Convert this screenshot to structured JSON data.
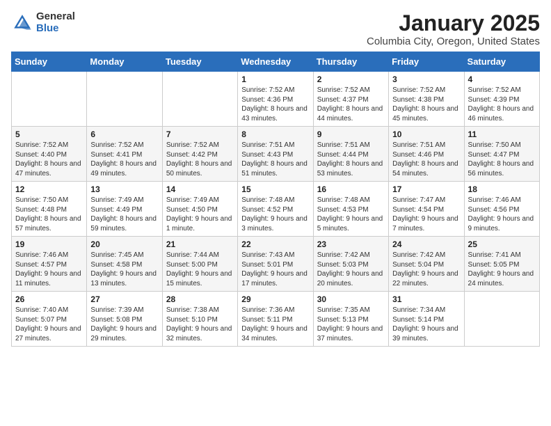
{
  "logo": {
    "general": "General",
    "blue": "Blue"
  },
  "header": {
    "title": "January 2025",
    "subtitle": "Columbia City, Oregon, United States"
  },
  "weekdays": [
    "Sunday",
    "Monday",
    "Tuesday",
    "Wednesday",
    "Thursday",
    "Friday",
    "Saturday"
  ],
  "weeks": [
    [
      {
        "day": "",
        "info": ""
      },
      {
        "day": "",
        "info": ""
      },
      {
        "day": "",
        "info": ""
      },
      {
        "day": "1",
        "info": "Sunrise: 7:52 AM\nSunset: 4:36 PM\nDaylight: 8 hours and 43 minutes."
      },
      {
        "day": "2",
        "info": "Sunrise: 7:52 AM\nSunset: 4:37 PM\nDaylight: 8 hours and 44 minutes."
      },
      {
        "day": "3",
        "info": "Sunrise: 7:52 AM\nSunset: 4:38 PM\nDaylight: 8 hours and 45 minutes."
      },
      {
        "day": "4",
        "info": "Sunrise: 7:52 AM\nSunset: 4:39 PM\nDaylight: 8 hours and 46 minutes."
      }
    ],
    [
      {
        "day": "5",
        "info": "Sunrise: 7:52 AM\nSunset: 4:40 PM\nDaylight: 8 hours and 47 minutes."
      },
      {
        "day": "6",
        "info": "Sunrise: 7:52 AM\nSunset: 4:41 PM\nDaylight: 8 hours and 49 minutes."
      },
      {
        "day": "7",
        "info": "Sunrise: 7:52 AM\nSunset: 4:42 PM\nDaylight: 8 hours and 50 minutes."
      },
      {
        "day": "8",
        "info": "Sunrise: 7:51 AM\nSunset: 4:43 PM\nDaylight: 8 hours and 51 minutes."
      },
      {
        "day": "9",
        "info": "Sunrise: 7:51 AM\nSunset: 4:44 PM\nDaylight: 8 hours and 53 minutes."
      },
      {
        "day": "10",
        "info": "Sunrise: 7:51 AM\nSunset: 4:46 PM\nDaylight: 8 hours and 54 minutes."
      },
      {
        "day": "11",
        "info": "Sunrise: 7:50 AM\nSunset: 4:47 PM\nDaylight: 8 hours and 56 minutes."
      }
    ],
    [
      {
        "day": "12",
        "info": "Sunrise: 7:50 AM\nSunset: 4:48 PM\nDaylight: 8 hours and 57 minutes."
      },
      {
        "day": "13",
        "info": "Sunrise: 7:49 AM\nSunset: 4:49 PM\nDaylight: 8 hours and 59 minutes."
      },
      {
        "day": "14",
        "info": "Sunrise: 7:49 AM\nSunset: 4:50 PM\nDaylight: 9 hours and 1 minute."
      },
      {
        "day": "15",
        "info": "Sunrise: 7:48 AM\nSunset: 4:52 PM\nDaylight: 9 hours and 3 minutes."
      },
      {
        "day": "16",
        "info": "Sunrise: 7:48 AM\nSunset: 4:53 PM\nDaylight: 9 hours and 5 minutes."
      },
      {
        "day": "17",
        "info": "Sunrise: 7:47 AM\nSunset: 4:54 PM\nDaylight: 9 hours and 7 minutes."
      },
      {
        "day": "18",
        "info": "Sunrise: 7:46 AM\nSunset: 4:56 PM\nDaylight: 9 hours and 9 minutes."
      }
    ],
    [
      {
        "day": "19",
        "info": "Sunrise: 7:46 AM\nSunset: 4:57 PM\nDaylight: 9 hours and 11 minutes."
      },
      {
        "day": "20",
        "info": "Sunrise: 7:45 AM\nSunset: 4:58 PM\nDaylight: 9 hours and 13 minutes."
      },
      {
        "day": "21",
        "info": "Sunrise: 7:44 AM\nSunset: 5:00 PM\nDaylight: 9 hours and 15 minutes."
      },
      {
        "day": "22",
        "info": "Sunrise: 7:43 AM\nSunset: 5:01 PM\nDaylight: 9 hours and 17 minutes."
      },
      {
        "day": "23",
        "info": "Sunrise: 7:42 AM\nSunset: 5:03 PM\nDaylight: 9 hours and 20 minutes."
      },
      {
        "day": "24",
        "info": "Sunrise: 7:42 AM\nSunset: 5:04 PM\nDaylight: 9 hours and 22 minutes."
      },
      {
        "day": "25",
        "info": "Sunrise: 7:41 AM\nSunset: 5:05 PM\nDaylight: 9 hours and 24 minutes."
      }
    ],
    [
      {
        "day": "26",
        "info": "Sunrise: 7:40 AM\nSunset: 5:07 PM\nDaylight: 9 hours and 27 minutes."
      },
      {
        "day": "27",
        "info": "Sunrise: 7:39 AM\nSunset: 5:08 PM\nDaylight: 9 hours and 29 minutes."
      },
      {
        "day": "28",
        "info": "Sunrise: 7:38 AM\nSunset: 5:10 PM\nDaylight: 9 hours and 32 minutes."
      },
      {
        "day": "29",
        "info": "Sunrise: 7:36 AM\nSunset: 5:11 PM\nDaylight: 9 hours and 34 minutes."
      },
      {
        "day": "30",
        "info": "Sunrise: 7:35 AM\nSunset: 5:13 PM\nDaylight: 9 hours and 37 minutes."
      },
      {
        "day": "31",
        "info": "Sunrise: 7:34 AM\nSunset: 5:14 PM\nDaylight: 9 hours and 39 minutes."
      },
      {
        "day": "",
        "info": ""
      }
    ]
  ]
}
